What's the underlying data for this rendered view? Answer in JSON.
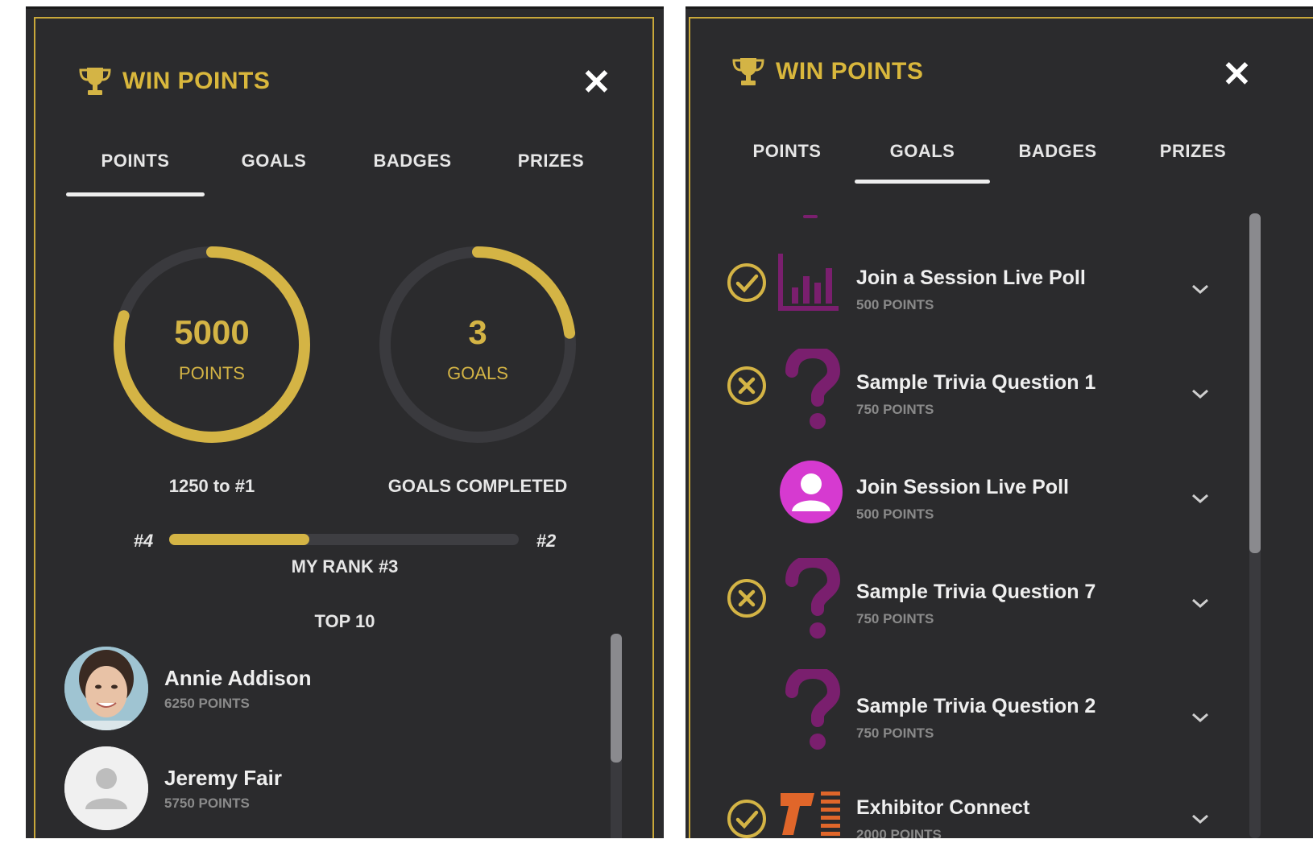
{
  "left_panel": {
    "title": "WIN POINTS",
    "tabs": [
      "POINTS",
      "GOALS",
      "BADGES",
      "PRIZES"
    ],
    "active_tab": "POINTS",
    "points_ring": {
      "value": "5000",
      "label": "POINTS",
      "progress": 0.8
    },
    "goals_ring": {
      "value": "3",
      "label": "GOALS",
      "progress": 0.23
    },
    "points_caption": "1250 to #1",
    "goals_caption": "GOALS COMPLETED",
    "rank": {
      "left_label": "#4",
      "right_label": "#2",
      "progress": 0.4,
      "my_rank": "MY RANK #3"
    },
    "top_heading": "TOP 10",
    "leaders": [
      {
        "name": "Annie Addison",
        "points": "6250 POINTS",
        "icon": "photo-avatar"
      },
      {
        "name": "Jeremy Fair",
        "points": "5750 POINTS",
        "icon": "default-avatar-icon"
      }
    ]
  },
  "right_panel": {
    "title": "WIN POINTS",
    "tabs": [
      "POINTS",
      "GOALS",
      "BADGES",
      "PRIZES"
    ],
    "active_tab": "GOALS",
    "goals": [
      {
        "name": "Join a Session Live Poll",
        "points": "500 POINTS",
        "status": "complete",
        "icon": "bar-chart-icon"
      },
      {
        "name": "Sample Trivia Question 1",
        "points": "750 POINTS",
        "status": "failed",
        "icon": "question-mark-icon"
      },
      {
        "name": "Join Session Live Poll",
        "points": "500 POINTS",
        "status": "none",
        "icon": "user-circle-icon"
      },
      {
        "name": "Sample Trivia Question 7",
        "points": "750 POINTS",
        "status": "failed",
        "icon": "question-mark-icon"
      },
      {
        "name": "Sample Trivia Question 2",
        "points": "750 POINTS",
        "status": "none",
        "icon": "question-mark-icon"
      },
      {
        "name": "Exhibitor Connect",
        "points": "2000 POINTS",
        "status": "complete",
        "icon": "barcode-scanner-icon"
      }
    ]
  },
  "colors": {
    "gold": "#d4b445",
    "panel": "#2b2b2d",
    "purple": "#7a1f6e",
    "magenta": "#d63ad0",
    "orange": "#e0662a"
  }
}
